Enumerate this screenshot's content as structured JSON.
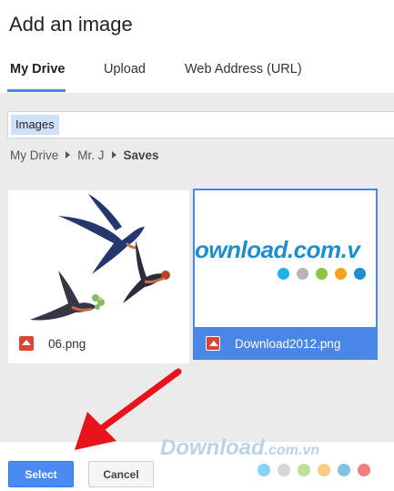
{
  "dialog": {
    "title": "Add an image"
  },
  "tabs": [
    {
      "label": "My Drive",
      "active": true
    },
    {
      "label": "Upload",
      "active": false
    },
    {
      "label": "Web Address (URL)",
      "active": false
    }
  ],
  "search": {
    "chip": "Images",
    "value": ""
  },
  "breadcrumb": [
    "My Drive",
    "Mr. J",
    "Saves"
  ],
  "files": [
    {
      "name": "06.png",
      "selected": false
    },
    {
      "name": "Download2012.png",
      "selected": true,
      "thumb_text": "ownload.com.v"
    }
  ],
  "buttons": {
    "select": "Select",
    "cancel": "Cancel"
  },
  "watermark": {
    "text": "Download",
    "suffix": ".com.vn"
  },
  "colors": {
    "accent": "#4285f4",
    "selected": "#4a86e8",
    "arrow": "#e8141c",
    "logo_dots": [
      "#21b0ec",
      "#b5b5b5",
      "#8bc541",
      "#f7a11d",
      "#1d8fcf"
    ]
  }
}
